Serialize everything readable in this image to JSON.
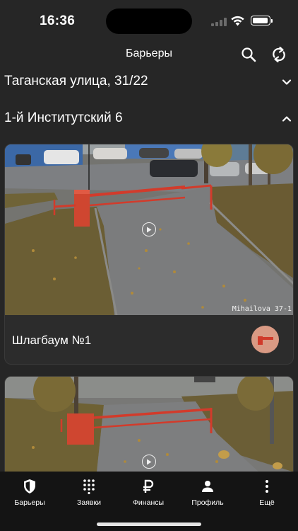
{
  "status_bar": {
    "time": "16:36"
  },
  "header": {
    "title": "Барьеры",
    "search_icon": "search-icon",
    "refresh_icon": "refresh-icon"
  },
  "addresses": [
    {
      "label": "Таганская улица, 31/22",
      "expanded": false
    },
    {
      "label": "1-й Институтский 6",
      "expanded": true
    }
  ],
  "cards": [
    {
      "name": "Шлагбаум №1",
      "camera_caption": "Mihailova 37-1",
      "barrier_icon": "barrier-icon"
    },
    {
      "name": "",
      "camera_caption": ""
    }
  ],
  "tabbar": {
    "tabs": [
      {
        "label": "Барьеры",
        "icon": "shield-icon",
        "active": true
      },
      {
        "label": "Заявки",
        "icon": "dialpad-icon",
        "active": false
      },
      {
        "label": "Финансы",
        "icon": "ruble-icon",
        "active": false
      },
      {
        "label": "Профиль",
        "icon": "person-icon",
        "active": false
      },
      {
        "label": "Ещё",
        "icon": "more-icon",
        "active": false
      }
    ]
  },
  "colors": {
    "background": "#262626",
    "card": "#2c2c2c",
    "tabbar": "#141414",
    "barrier_button": "#d99a84",
    "barrier_red": "#d03a2a"
  }
}
